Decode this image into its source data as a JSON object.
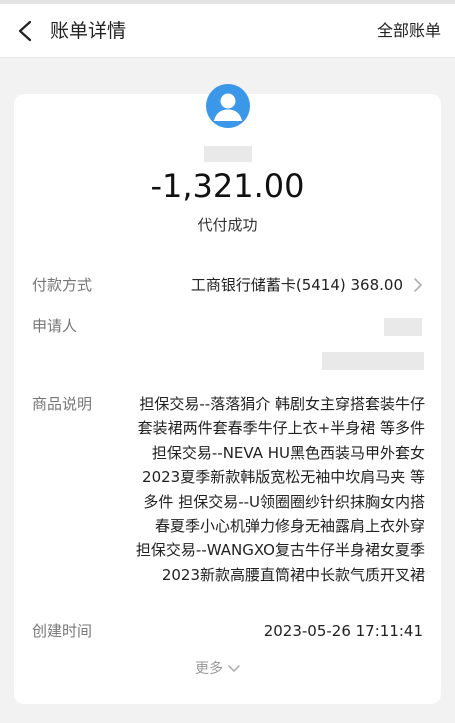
{
  "header": {
    "title": "账单详情",
    "right_link": "全部账单",
    "back_icon": "back-chevron-icon"
  },
  "summary": {
    "avatar_icon": "user-avatar-icon",
    "avatar_color": "#3b97e8",
    "amount": "-1,321.00",
    "status": "代付成功"
  },
  "details": {
    "payment_method": {
      "label": "付款方式",
      "value": "工商银行储蓄卡(5414)  368.00"
    },
    "applicant": {
      "label": "申请人"
    },
    "description": {
      "label": "商品说明",
      "lines": [
        "担保交易--落落狷介 韩剧女主穿搭套装牛仔",
        "套装裙两件套春季牛仔上衣+半身裙 等多件",
        "担保交易--NEVA HU黑色西装马甲外套女",
        "2023夏季新款韩版宽松无袖中坎肩马夹 等",
        "多件 担保交易--U领圈圈纱针织抹胸女内搭",
        "春夏季小心机弹力修身无袖露肩上衣外穿",
        "担保交易--WANGXO复古牛仔半身裙女夏季",
        "2023新款高腰直筒裙中长款气质开叉裙"
      ]
    },
    "created_time": {
      "label": "创建时间",
      "value": "2023-05-26 17:11:41"
    }
  },
  "more_label": "更多"
}
